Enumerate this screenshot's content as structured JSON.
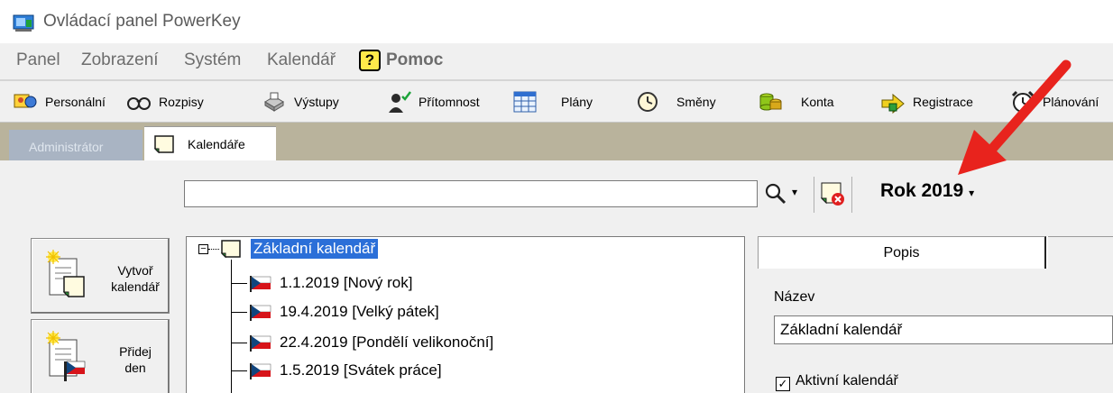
{
  "window": {
    "title": "Ovládací panel PowerKey"
  },
  "menu": {
    "items": [
      "Panel",
      "Zobrazení",
      "Systém",
      "Kalendář"
    ],
    "help_badge": "?",
    "help": "Pomoc"
  },
  "toolbar": {
    "buttons": [
      {
        "label": "Personální",
        "icon": "personnel-icon"
      },
      {
        "label": "Rozpisy",
        "icon": "glasses-icon"
      },
      {
        "label": "Výstupy",
        "icon": "printer-icon"
      },
      {
        "label": "Přítomnost",
        "icon": "attendance-icon"
      },
      {
        "label": "Plány",
        "icon": "calendar-grid-icon"
      },
      {
        "label": "Směny",
        "icon": "clock-icon"
      },
      {
        "label": "Konta",
        "icon": "coins-icon"
      },
      {
        "label": "Registrace",
        "icon": "register-arrow-icon"
      },
      {
        "label": "Plánování",
        "icon": "alarm-clock-icon"
      }
    ]
  },
  "tabs": [
    {
      "label": "Administrátor",
      "active": false
    },
    {
      "label": "Kalendáře",
      "active": true
    }
  ],
  "search": {
    "value": "",
    "dropdown_glyph": "▾"
  },
  "year_selector": {
    "label": "Rok 2019",
    "caret": "▾"
  },
  "side_buttons": [
    {
      "label_line1": "Vytvoř",
      "label_line2": "kalendář"
    },
    {
      "label_line1": "Přidej",
      "label_line2": "den"
    }
  ],
  "tree": {
    "root": {
      "expander": "−",
      "label": "Základní kalendář",
      "selected": true
    },
    "children": [
      "1.1.2019 [Nový rok]",
      "19.4.2019 [Velký pátek]",
      "22.4.2019 [Pondělí velikonoční]",
      "1.5.2019 [Svátek práce]"
    ]
  },
  "detail": {
    "tab_label": "Popis",
    "name_label": "Název",
    "name_value": "Základní kalendář",
    "active_label": "Aktivní kalendář",
    "active_checked": true,
    "active_mark": "✓"
  },
  "colors": {
    "selection": "#2b6fd8",
    "tab_strip": "#b9b39c",
    "annotation_arrow": "#e8231d"
  }
}
